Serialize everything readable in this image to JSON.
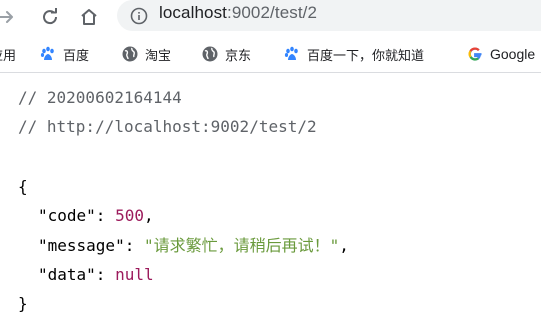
{
  "toolbar": {
    "url_host": "localhost",
    "url_path": ":9002/test/2"
  },
  "bookmarks": [
    {
      "label": "应用",
      "icon": "apps-icon"
    },
    {
      "label": "百度",
      "icon": "baidu-paw-icon"
    },
    {
      "label": "淘宝",
      "icon": "globe-icon"
    },
    {
      "label": "京东",
      "icon": "globe-icon"
    },
    {
      "label": "百度一下，你就知道",
      "icon": "baidu-paw-icon"
    },
    {
      "label": "Google",
      "icon": "google-g-icon"
    }
  ],
  "json_view": {
    "comment_time": "// 20200602164144",
    "comment_url": "// http://localhost:9002/test/2",
    "open_brace": "{",
    "close_brace": "}",
    "code_key": "\"code\"",
    "code_value": "500",
    "message_key": "\"message\"",
    "message_value": "\"请求繁忙，请稍后再试！\"",
    "data_key": "\"data\"",
    "data_value": "null"
  },
  "colors": {
    "number": "#9c1b5c",
    "string": "#6a9a3c",
    "comment": "#5f6368"
  }
}
